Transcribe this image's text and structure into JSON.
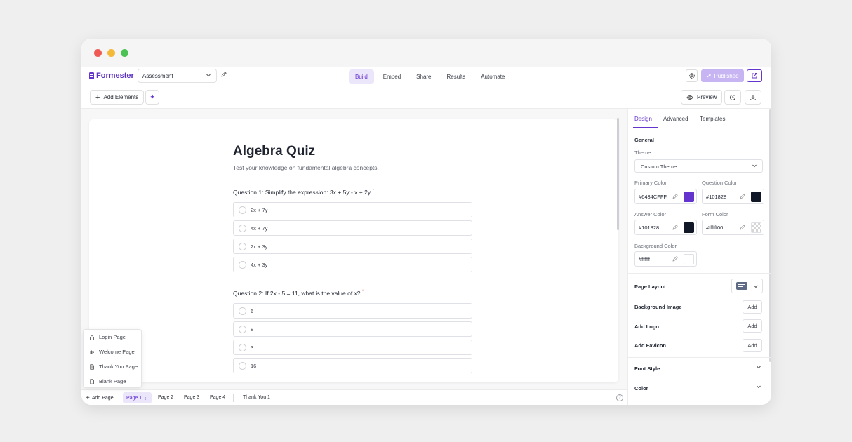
{
  "topbar": {
    "brand": "Formester",
    "form_selector_value": "Assessment",
    "nav_tabs": [
      "Build",
      "Embed",
      "Share",
      "Results",
      "Automate"
    ],
    "published_label": "Published"
  },
  "toolbar": {
    "add_elements_label": "Add Elements",
    "preview_label": "Preview"
  },
  "form": {
    "title": "Algebra Quiz",
    "description": "Test your knowledge on fundamental algebra concepts.",
    "questions": [
      {
        "label": "Question 1: Simplify the expression: 3x + 5y - x + 2y",
        "required_mark": "*",
        "options": [
          "2x + 7y",
          "4x + 7y",
          "2x + 3y",
          "4x + 3y"
        ]
      },
      {
        "label": "Question 2: If 2x - 5 = 11, what is the value of x?",
        "required_mark": "*",
        "options": [
          "6",
          "8",
          "3",
          "16"
        ]
      }
    ]
  },
  "page_menu": [
    "Login Page",
    "Welcome Page",
    "Thank You Page",
    "Blank Page"
  ],
  "pagebar": {
    "add_page_label": "Add Page",
    "pages": [
      "Page 1",
      "Page 2",
      "Page 3",
      "Page 4"
    ],
    "active_page_more": "⋮",
    "thank_you_label": "Thank You 1"
  },
  "panel": {
    "tabs": [
      "Design",
      "Advanced",
      "Templates"
    ],
    "general_title": "General",
    "theme_label": "Theme",
    "theme_value": "Custom Theme",
    "colors": {
      "primary_label": "Primary Color",
      "primary_value": "#6434CFFF",
      "question_label": "Question Color",
      "question_value": "#101828",
      "answer_label": "Answer Color",
      "answer_value": "#101828",
      "form_label": "Form Color",
      "form_value": "#ffffff00",
      "background_label": "Background Color",
      "background_value": "#ffffff"
    },
    "page_layout_label": "Page Layout",
    "background_image_label": "Background Image",
    "add_logo_label": "Add Logo",
    "add_favicon_label": "Add Favicon",
    "add_button_label": "Add",
    "font_style_label": "Font Style",
    "color_label": "Color"
  },
  "swatch_colors": {
    "primary": "#6434cf",
    "question": "#101828",
    "answer": "#101828",
    "background": "#ffffff"
  }
}
